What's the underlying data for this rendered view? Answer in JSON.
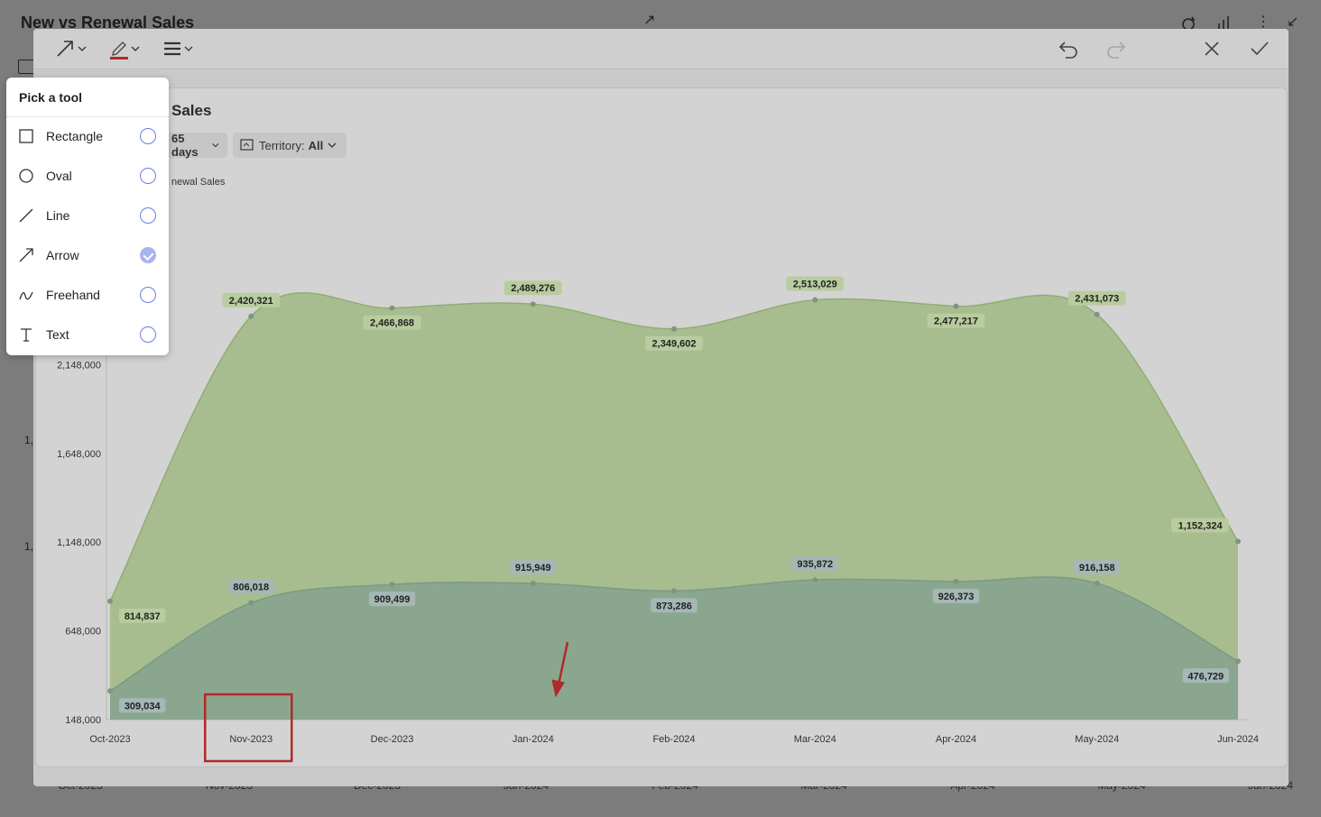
{
  "background": {
    "title": "New vs Renewal Sales",
    "x_labels": [
      "Oct-2023",
      "Nov-2023",
      "Dec-2023",
      "Jan-2024",
      "Feb-2024",
      "Mar-2024",
      "Apr-2024",
      "May-2024",
      "Jun-2024"
    ],
    "y_fragments": [
      "1,",
      "1,"
    ]
  },
  "toolbar": {
    "tool_icon": "arrow-icon",
    "color_icon": "pen-color-icon",
    "stroke_icon": "line-weight-icon",
    "pen_color": "#b02a2a",
    "undo_icon": "undo-icon",
    "redo_icon": "redo-icon",
    "close_icon": "close-icon",
    "confirm_icon": "check-icon"
  },
  "card": {
    "title": "Sales",
    "date_filter_value": "65 days",
    "territory_label": "Territory:",
    "territory_value": "All",
    "legend_fragment": "newal Sales"
  },
  "popover": {
    "title": "Pick a tool",
    "tools": [
      {
        "label": "Rectangle",
        "icon": "rectangle-icon",
        "selected": false
      },
      {
        "label": "Oval",
        "icon": "oval-icon",
        "selected": false
      },
      {
        "label": "Line",
        "icon": "line-icon",
        "selected": false
      },
      {
        "label": "Arrow",
        "icon": "arrow-icon",
        "selected": true
      },
      {
        "label": "Freehand",
        "icon": "freehand-icon",
        "selected": false
      },
      {
        "label": "Text",
        "icon": "text-icon",
        "selected": false
      }
    ]
  },
  "annotations": {
    "color": "#b02a2a",
    "rectangle_around": "Nov-2023",
    "arrow_points_to": "Jan-2024"
  },
  "chart_data": {
    "type": "area",
    "categories": [
      "Oct-2023",
      "Nov-2023",
      "Dec-2023",
      "Jan-2024",
      "Feb-2024",
      "Mar-2024",
      "Apr-2024",
      "May-2024",
      "Jun-2024"
    ],
    "y_ticks": [
      "148,000",
      "648,000",
      "1,148,000",
      "1,648,000",
      "2,148,000"
    ],
    "ylim": [
      148000,
      2648000
    ],
    "series": [
      {
        "color": "#a8bd8f",
        "line": "#8fae73",
        "label_bg": "#b9cc9f",
        "values": [
          814837,
          2420321,
          2466868,
          2489276,
          2349602,
          2513029,
          2477217,
          2431073,
          1152324
        ]
      },
      {
        "color": "#8aa68e",
        "line": "#7a9a83",
        "label_bg": "#a5b8b6",
        "values": [
          309034,
          806018,
          909499,
          915949,
          873286,
          935872,
          926373,
          916158,
          476729
        ]
      }
    ],
    "value_labels": [
      [
        "814,837",
        "2,420,321",
        "2,466,868",
        "2,489,276",
        "2,349,602",
        "2,513,029",
        "2,477,217",
        "2,431,073",
        "1,152,324"
      ],
      [
        "309,034",
        "806,018",
        "909,499",
        "915,949",
        "873,286",
        "935,872",
        "926,373",
        "916,158",
        "476,729"
      ]
    ],
    "label_above": [
      [
        false,
        true,
        false,
        true,
        false,
        true,
        false,
        true,
        true
      ],
      [
        false,
        true,
        false,
        true,
        false,
        true,
        false,
        true,
        false
      ]
    ]
  }
}
